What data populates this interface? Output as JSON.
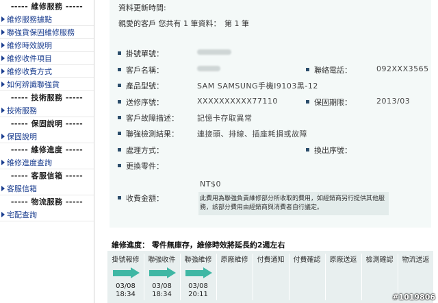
{
  "sidebar": {
    "sections": [
      {
        "title": "----- 維修服務 -----",
        "items": [
          "維修服務據點",
          "聯強貨保固維修服務",
          "維修時效說明",
          "維修收件項目",
          "維修收費方式",
          "如何辨識聯強貨"
        ]
      },
      {
        "title": "----- 技術服務 -----",
        "items": [
          "技術服務"
        ]
      },
      {
        "title": "----- 保固說明 -----",
        "items": [
          "保固說明"
        ]
      },
      {
        "title": "----- 維修進度 -----",
        "items": [
          "維修進度查詢"
        ]
      },
      {
        "title": "----- 客服信箱 -----",
        "items": [
          "客服信箱"
        ]
      },
      {
        "title": "----- 物流服務 -----",
        "items": [
          "宅配查詢"
        ]
      }
    ]
  },
  "header": {
    "updated_label": "資料更新時間:",
    "summary": "親愛的客戶 您共有 1 筆資料：　第 1 筆"
  },
  "fields": {
    "ticket_no_label": "掛號單號：",
    "customer_label": "客戶名稱：",
    "phone_label": "聯絡電話：",
    "phone_value": "092XXX3565",
    "model_label": "產品型號：",
    "model_value": "SAM SAMSUNG手機I9103黑-12",
    "serial_label": "送修序號：",
    "serial_value": "XXXXXXXXXX77110",
    "warranty_label": "保固期限：",
    "warranty_value": "2013/03",
    "fault_label": "客戶故障描述：",
    "fault_value": "記憶卡存取異常",
    "test_label": "聯強檢測結果：",
    "test_value": "連接頭、排線、插座耗損或故障",
    "handling_label": "處理方式：",
    "swap_label": "換出序號：",
    "parts_label": "更換零件：",
    "fee_label": "收費金額：",
    "fee_value": "NT$0",
    "fee_note": "此費用為聯強負責維修部分所收取的費用，如經銷商另行提供其他服務，該部分費用由經銷商與消費者自行議定。"
  },
  "progress": {
    "title": "維修進度： 零件無庫存，維修時效將延長約2週左右",
    "steps": [
      {
        "label": "掛號報修",
        "date": "03/08",
        "time": "18:34",
        "done": true
      },
      {
        "label": "聯強收件",
        "date": "03/08",
        "time": "18:34",
        "done": true
      },
      {
        "label": "聯強維修",
        "date": "03/08",
        "time": "20:11",
        "done": true
      },
      {
        "label": "原廠維修",
        "date": "",
        "time": "",
        "done": false
      },
      {
        "label": "付費通知",
        "date": "",
        "time": "",
        "done": false
      },
      {
        "label": "付費確認",
        "date": "",
        "time": "",
        "done": false
      },
      {
        "label": "原廠送返",
        "date": "",
        "time": "",
        "done": false
      },
      {
        "label": "檢測確認",
        "date": "",
        "time": "",
        "done": false
      },
      {
        "label": "物流送返",
        "date": "",
        "time": "",
        "done": false
      }
    ]
  },
  "watermark": "#1019806",
  "colors": {
    "accent": "#3fb7a4",
    "link": "#1a3d8f",
    "panel": "#f4f9f8"
  }
}
